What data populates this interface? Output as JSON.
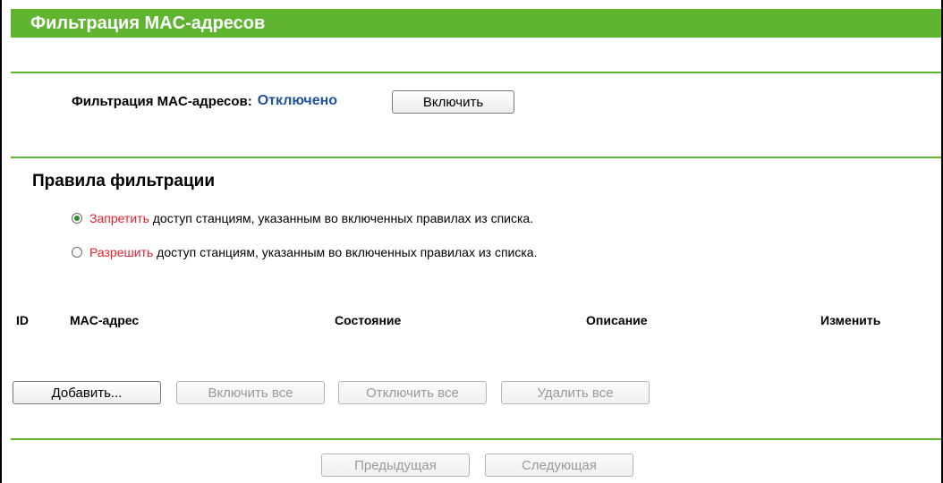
{
  "header": {
    "title": "Фильтрация MAC-адресов"
  },
  "status": {
    "label": "Фильтрация MAC-адресов:",
    "value": "Отключено",
    "enable_button": "Включить"
  },
  "rules": {
    "title": "Правила фильтрации",
    "options": [
      {
        "highlight": "Запретить",
        "text": " доступ станциям, указанным во включенных правилах из списка.",
        "checked": true
      },
      {
        "highlight": "Разрешить",
        "text": " доступ станциям, указанным во включенных правилах из списка.",
        "checked": false
      }
    ]
  },
  "table": {
    "columns": [
      "ID",
      "MAC-адрес",
      "Состояние",
      "Описание",
      "Изменить"
    ]
  },
  "actions": {
    "add": "Добавить...",
    "enable_all": "Включить все",
    "disable_all": "Отключить все",
    "delete_all": "Удалить все"
  },
  "pager": {
    "prev": "Предыдущая",
    "next": "Следующая"
  },
  "colors": {
    "accent": "#5fb430",
    "status_value": "#1f50a4",
    "highlight": "#e8202a"
  }
}
